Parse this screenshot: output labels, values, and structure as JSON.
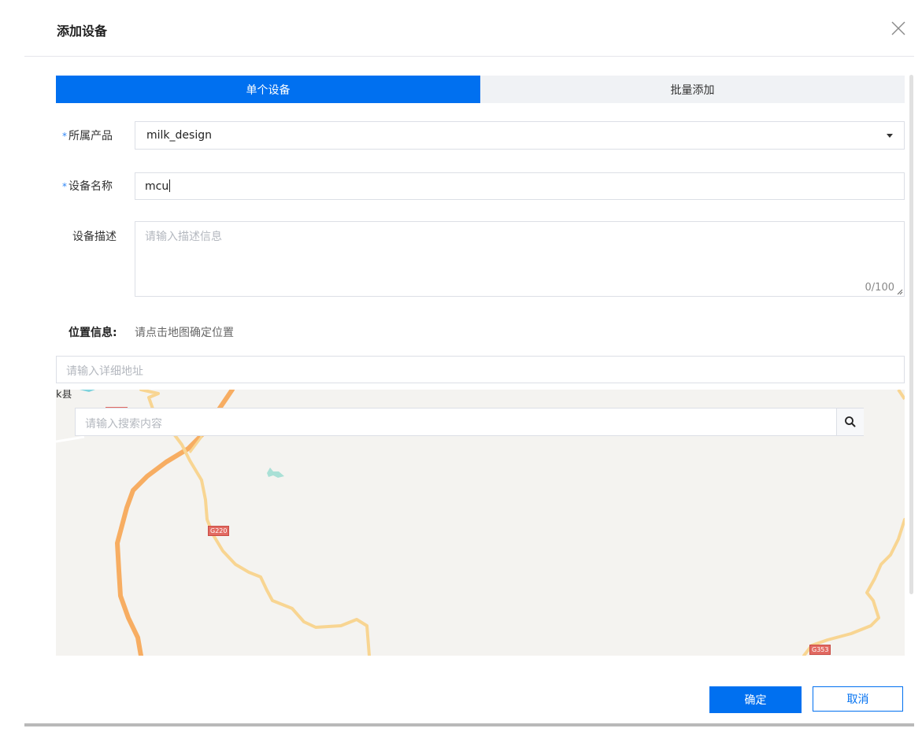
{
  "dialog": {
    "title": "添加设备"
  },
  "tabs": [
    {
      "label": "单个设备",
      "active": true
    },
    {
      "label": "批量添加",
      "active": false
    }
  ],
  "form": {
    "required_mark": "*",
    "product": {
      "label": "所属产品",
      "value": "milk_design"
    },
    "device_name": {
      "label": "设备名称",
      "value": "mcu"
    },
    "description": {
      "label": "设备描述",
      "placeholder": "请输入描述信息",
      "counter": "0/100"
    },
    "location": {
      "label": "位置信息:",
      "hint": "请点击地图确定位置"
    },
    "address": {
      "placeholder": "请输入详细地址"
    }
  },
  "map": {
    "search_placeholder": "请输入搜索内容",
    "road_labels": [
      "G220",
      "G353"
    ],
    "place_fragment": "k县"
  },
  "footer": {
    "ok_label": "确定",
    "cancel_label": "取消"
  },
  "colors": {
    "primary": "#0070f0",
    "tab_inactive": "#f0f2f5",
    "map_bg": "#f4f3f0",
    "road_major": "#f7ad62",
    "road_minor": "#f8d592"
  }
}
